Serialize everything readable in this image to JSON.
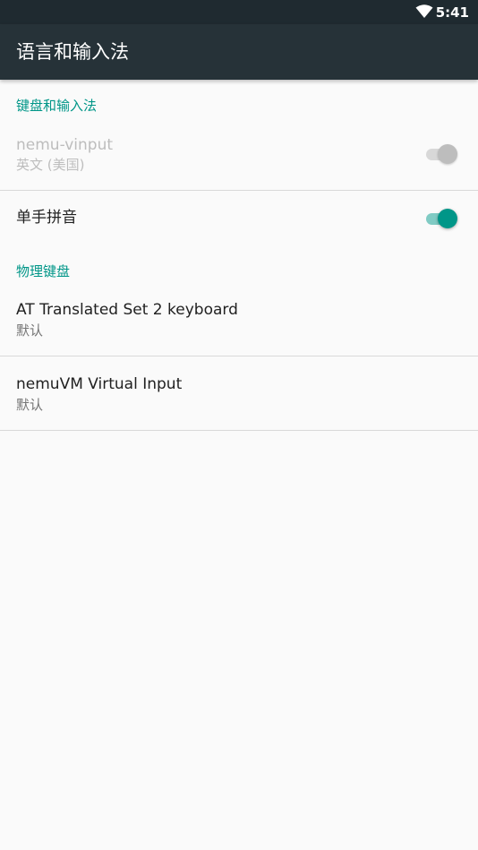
{
  "status_bar": {
    "time": "5:41",
    "wifi_icon": "wifi-icon"
  },
  "app_bar": {
    "title": "语言和输入法"
  },
  "sections": {
    "keyboard_input": {
      "header": "键盘和输入法",
      "items": [
        {
          "title": "nemu-vinput",
          "summary": "英文 (美国)",
          "enabled": false,
          "switch_on": true
        },
        {
          "title": "单手拼音",
          "enabled": true,
          "switch_on": true
        }
      ]
    },
    "physical_keyboard": {
      "header": "物理键盘",
      "items": [
        {
          "title": "AT Translated Set 2 keyboard",
          "summary": "默认"
        },
        {
          "title": "nemuVM Virtual Input",
          "summary": "默认"
        }
      ]
    }
  },
  "colors": {
    "status_bar": "#1f2a30",
    "app_bar": "#263238",
    "accent": "#009688",
    "background": "#fafafa"
  }
}
